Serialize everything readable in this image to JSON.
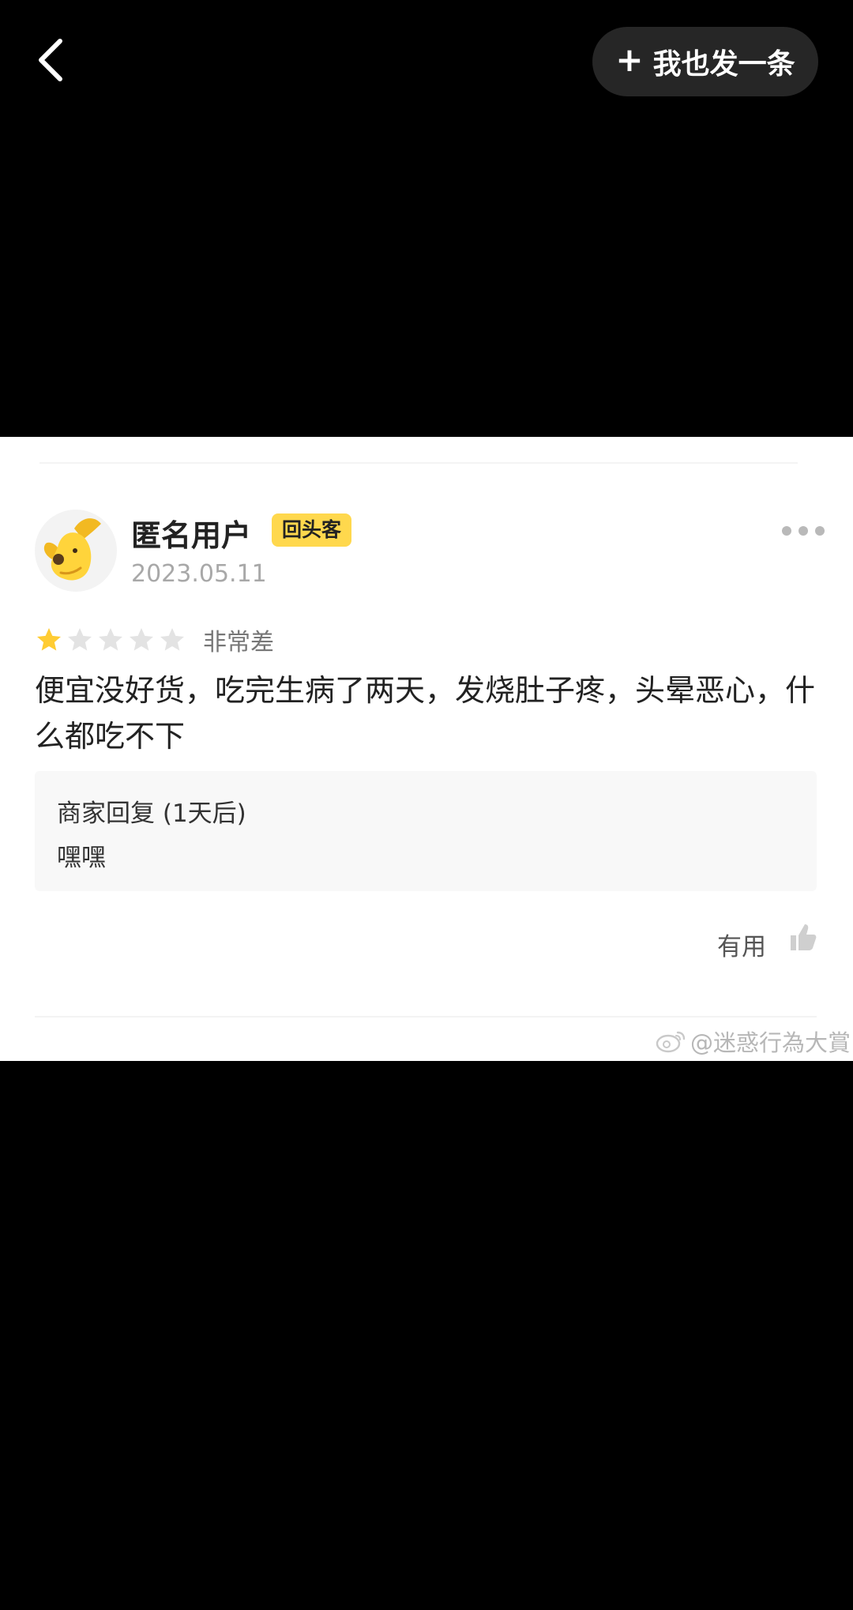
{
  "header": {
    "back_icon": "chevron-left-icon",
    "post_button_label": "我也发一条",
    "post_button_plus": "+"
  },
  "review": {
    "username": "匿名用户",
    "badge": "回头客",
    "date": "2023.05.11",
    "rating": 1,
    "rating_max": 5,
    "rating_label": "非常差",
    "text": "便宜没好货，吃完生病了两天，发烧肚子疼，头晕恶心，什么都吃不下",
    "reply_title": "商家回复 (1天后)",
    "reply_content": "嘿嘿",
    "useful_label": "有用"
  },
  "watermark": {
    "text": "@迷惑行為大賞",
    "icon": "weibo-icon"
  },
  "colors": {
    "background": "#000000",
    "card": "#ffffff",
    "badge": "#ffd84d",
    "star_active": "#ffcc33",
    "star_inactive": "#e3e3e3"
  }
}
